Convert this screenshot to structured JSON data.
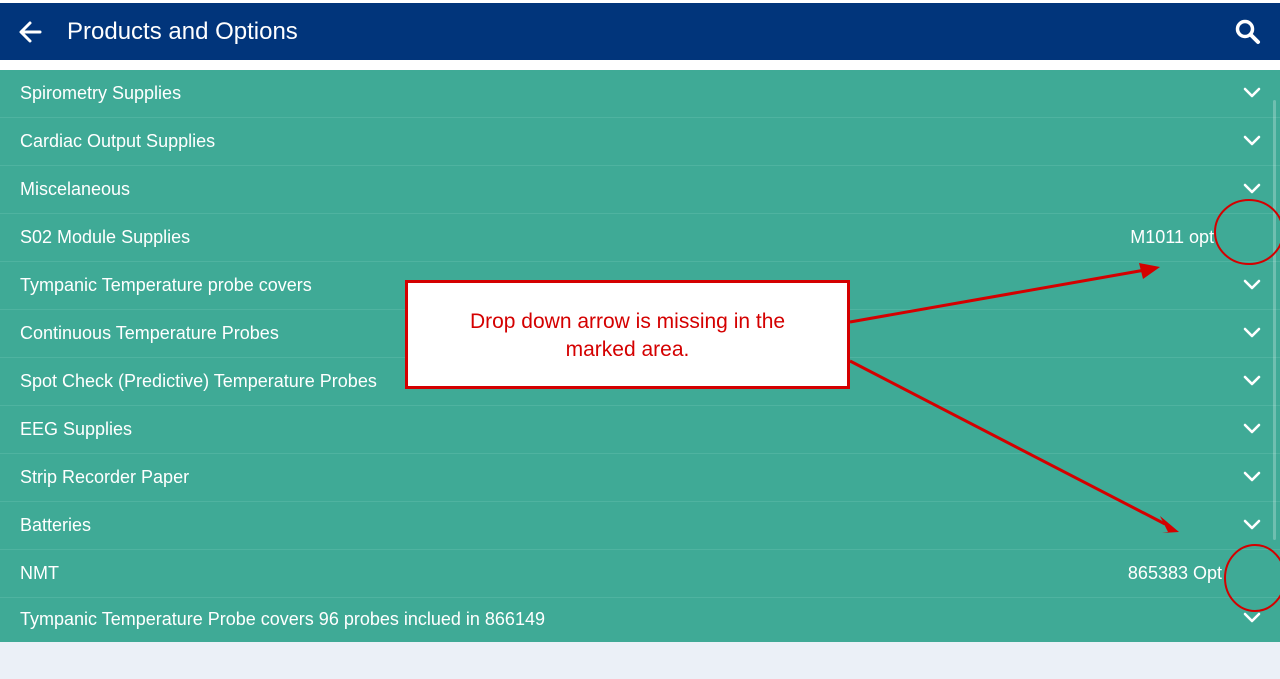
{
  "header": {
    "title": "Products and Options",
    "back_icon": "arrow-left-icon",
    "search_icon": "search-icon",
    "background": "#01357b"
  },
  "list": {
    "background": "#3faa96",
    "items": [
      {
        "label": "Spirometry Supplies",
        "meta": "",
        "chevron": true
      },
      {
        "label": "Cardiac Output Supplies",
        "meta": "",
        "chevron": true
      },
      {
        "label": "Miscelaneous",
        "meta": "",
        "chevron": true
      },
      {
        "label": "S02 Module Supplies",
        "meta": "M1011 opt",
        "chevron": false
      },
      {
        "label": "Tympanic Temperature probe covers",
        "meta": "",
        "chevron": true
      },
      {
        "label": "Continuous Temperature Probes",
        "meta": "",
        "chevron": true
      },
      {
        "label": "Spot Check (Predictive) Temperature Probes",
        "meta": "",
        "chevron": true
      },
      {
        "label": "EEG Supplies",
        "meta": "",
        "chevron": true
      },
      {
        "label": "Strip Recorder Paper",
        "meta": "",
        "chevron": true
      },
      {
        "label": "Batteries",
        "meta": "",
        "chevron": true
      },
      {
        "label": "NMT",
        "meta": "865383 Opt",
        "chevron": false
      },
      {
        "label": "Tympanic Temperature Probe covers 96 probes inclued in 866149",
        "meta": "",
        "chevron": true
      }
    ]
  },
  "annotation": {
    "text": "Drop down arrow is missing in the marked area.",
    "color": "#d40000"
  }
}
